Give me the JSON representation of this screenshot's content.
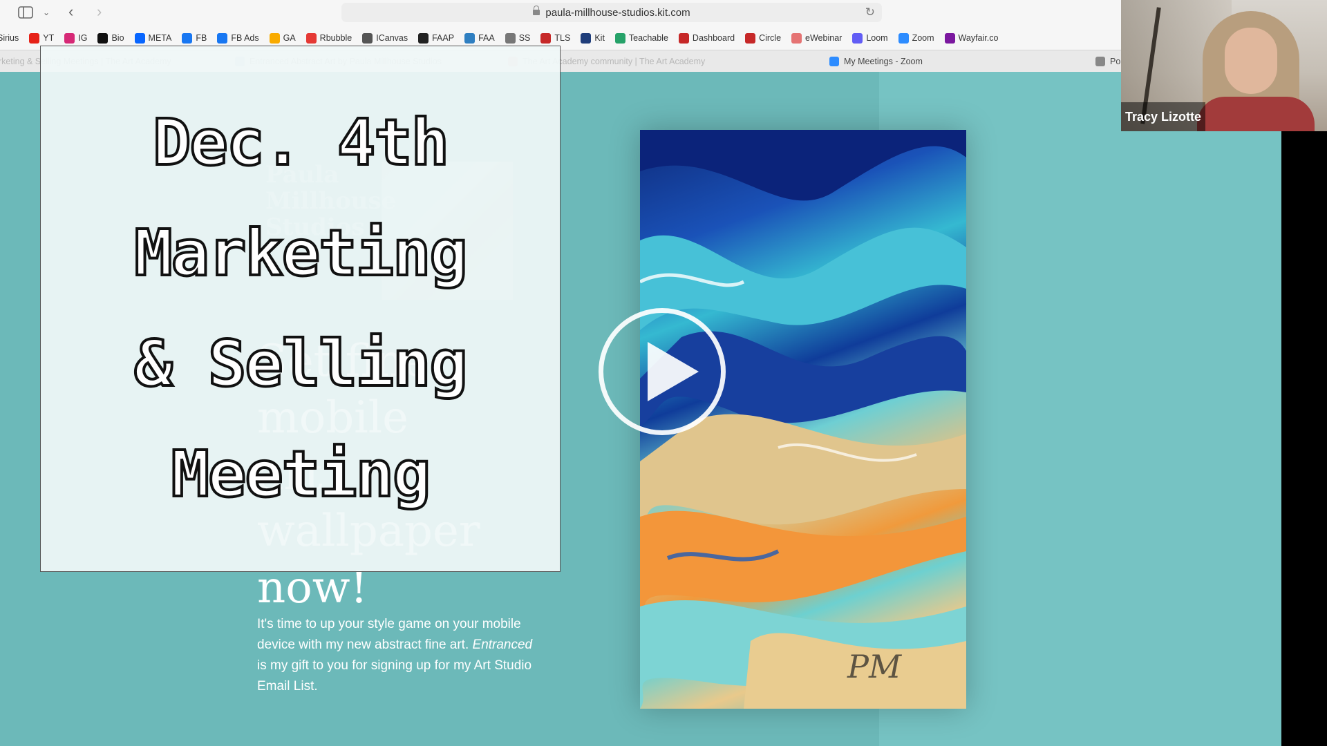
{
  "browser": {
    "url": "paula-millhouse-studios.kit.com",
    "bookmarks": [
      {
        "label": "Sirius",
        "icon": "sirius-icon",
        "color": ""
      },
      {
        "label": "YT",
        "icon": "youtube-icon",
        "color": "#e62117"
      },
      {
        "label": "IG",
        "icon": "instagram-icon",
        "color": "#d62976"
      },
      {
        "label": "Bio",
        "icon": "bio-icon",
        "color": "#111111"
      },
      {
        "label": "META",
        "icon": "meta-icon",
        "color": "#0866ff"
      },
      {
        "label": "FB",
        "icon": "facebook-icon",
        "color": "#1877f2"
      },
      {
        "label": "FB Ads",
        "icon": "facebook-icon",
        "color": "#1877f2"
      },
      {
        "label": "GA",
        "icon": "analytics-icon",
        "color": "#f9ab00"
      },
      {
        "label": "Rbubble",
        "icon": "rbubble-icon",
        "color": "#e53935"
      },
      {
        "label": "ICanvas",
        "icon": "icanvas-icon",
        "color": "#555555"
      },
      {
        "label": "FAAP",
        "icon": "tl-icon",
        "color": "#222222"
      },
      {
        "label": "FAA",
        "icon": "faa-icon",
        "color": "#2f7fc1"
      },
      {
        "label": "SS",
        "icon": "ss-icon",
        "color": "#777777"
      },
      {
        "label": "TLS",
        "icon": "tls-icon",
        "color": "#c62828"
      },
      {
        "label": "Kit",
        "icon": "kit-icon",
        "color": "#1f3d7a"
      },
      {
        "label": "Teachable",
        "icon": "teachable-icon",
        "color": "#26a269"
      },
      {
        "label": "Dashboard",
        "icon": "dashboard-icon",
        "color": "#c62828"
      },
      {
        "label": "Circle",
        "icon": "circle-icon",
        "color": "#c62828"
      },
      {
        "label": "eWebinar",
        "icon": "ewebinar-icon",
        "color": "#e57373"
      },
      {
        "label": "Loom",
        "icon": "loom-icon",
        "color": "#625df5"
      },
      {
        "label": "Zoom",
        "icon": "zoom-icon",
        "color": "#2d8cff"
      },
      {
        "label": "Wayfair.co",
        "icon": "wayfair-icon",
        "color": "#7b189f"
      }
    ],
    "tabs": [
      {
        "label": "rketing & Selling Meetings | The Art Academy",
        "icon": "",
        "faded": true
      },
      {
        "label": "Entranced Abstract Art by Paula Millhouse Studios",
        "icon": "kit-icon",
        "faded": true
      },
      {
        "label": "The Art Academy community | The Art Academy",
        "icon": "circle-icon",
        "faded": true
      },
      {
        "label": "My Meetings - Zoom",
        "icon": "zoom-icon",
        "faded": false
      },
      {
        "label": "Po",
        "icon": "z-icon",
        "faded": false
      }
    ]
  },
  "page": {
    "logo_lines": [
      "Paula",
      "Millhouse",
      "Studios"
    ],
    "headline_lines": [
      "Set fine",
      "mobile",
      "art",
      "wallpaper",
      "now!"
    ],
    "body_before": "It's time to up your style game on your mobile device with my new abstract fine art. ",
    "body_em": "Entranced",
    "body_after": " is my gift to you for signing up for my Art Studio Email List.",
    "signature": "PM"
  },
  "overlay": {
    "lines": [
      "Dec. 4th",
      "Marketing",
      "& Selling",
      "Meeting"
    ]
  },
  "webcam": {
    "name": "Tracy Lizotte"
  }
}
